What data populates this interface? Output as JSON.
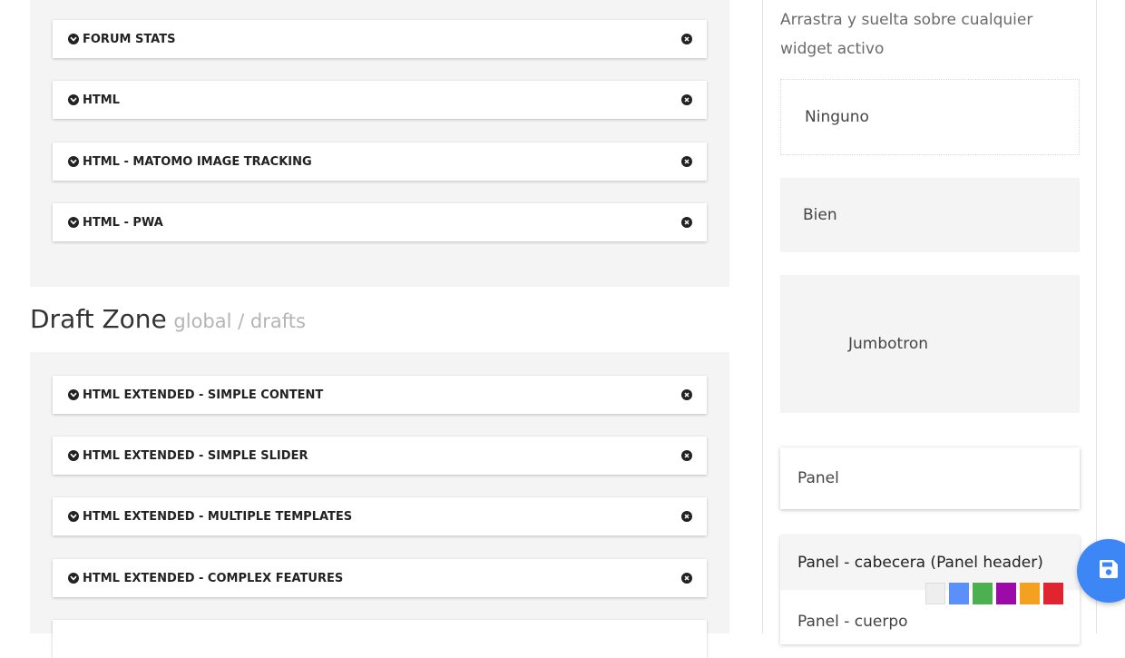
{
  "forum_zone": {
    "widgets": [
      {
        "title": "FORUM STATS"
      },
      {
        "title": "HTML"
      },
      {
        "title": "HTML - MATOMO IMAGE TRACKING"
      },
      {
        "title": "HTML - PWA"
      }
    ]
  },
  "draft_zone": {
    "heading": "Draft Zone",
    "subheading": "global / drafts",
    "widgets": [
      {
        "title": "HTML EXTENDED - SIMPLE CONTENT"
      },
      {
        "title": "HTML EXTENDED - SIMPLE SLIDER"
      },
      {
        "title": "HTML EXTENDED - MULTIPLE TEMPLATES"
      },
      {
        "title": "HTML EXTENDED - COMPLEX FEATURES"
      }
    ]
  },
  "sidebar": {
    "hint": "Arrastra y suelta sobre cualquier widget activo",
    "styles": {
      "ninguno": "Ninguno",
      "bien": "Bien",
      "jumbotron": "Jumbotron",
      "panel": "Panel",
      "panel_header": "Panel - cabecera (Panel header)",
      "panel_body": "Panel - cuerpo"
    }
  },
  "swatches": [
    "#eeeeee",
    "#5b8ff9",
    "#4caf50",
    "#9c0aa8",
    "#f4a020",
    "#e02530"
  ],
  "icons": {
    "widget_toggle": "chevron-down-circle-icon",
    "widget_remove": "close-circle-icon",
    "save": "save-icon"
  }
}
